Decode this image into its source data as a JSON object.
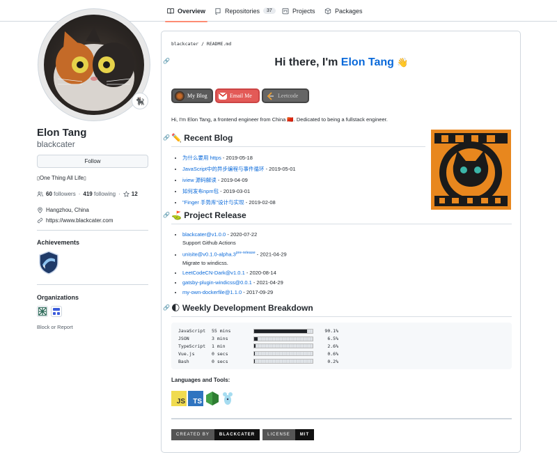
{
  "nav": {
    "tabs": [
      {
        "label": "Overview",
        "icon": "book-icon"
      },
      {
        "label": "Repositories",
        "count": "37",
        "icon": "repo-icon"
      },
      {
        "label": "Projects",
        "icon": "project-icon"
      },
      {
        "label": "Packages",
        "icon": "package-icon"
      }
    ]
  },
  "profile": {
    "name": "Elon Tang",
    "login": "blackcater",
    "status_emoji": "🐈‍⬛",
    "follow_label": "Follow",
    "bio": "One Thing All Life",
    "followers_count": "60",
    "followers_label": "followers",
    "following_count": "419",
    "following_label": "following",
    "stars_count": "12",
    "location": "Hangzhou, China",
    "website": "https://www.blackcater.com"
  },
  "sidebar": {
    "achievements_heading": "Achievements",
    "organizations_heading": "Organizations",
    "block_report": "Block or Report"
  },
  "readme": {
    "breadcrumb_user": "blackcater",
    "breadcrumb_sep": "/",
    "breadcrumb_file": "README.md",
    "greeting": "Hi there, I'm ",
    "greeting_name": "Elon Tang",
    "greeting_emoji": "👋",
    "badges": {
      "blog": "My Blog",
      "email": "Email Me",
      "leetcode": "Leetcode"
    },
    "intro": "Hi, I'm Elon Tang, a frontend engineer from China 🇨🇳. Dedicated to being a fullstack engineer.",
    "recent_blog_heading": "✏️ Recent Blog",
    "blog_posts": [
      {
        "title": "为什么要用 https",
        "date": " - 2019-05-18"
      },
      {
        "title": "JavaScript中的异步编程与事件循环",
        "date": " - 2019-05-01"
      },
      {
        "title": "iview 源码解读",
        "date": " - 2019-04-09"
      },
      {
        "title": "如何发布npm包",
        "date": " - 2019-03-01"
      },
      {
        "title": "\"Finger 手势库\"设计与实现",
        "date": " - 2019-02-08"
      }
    ],
    "project_release_heading": "⛳ Project Release",
    "releases": [
      {
        "title": "blackcater@v1.0.0",
        "sup": "",
        "date": " - 2020-07-22",
        "note": "Support Github Actions"
      },
      {
        "title": "unisite@v0.1.0-alpha.3",
        "sup": "pre-release",
        "date": " - 2021-04-29",
        "note": "Migrate to windicss."
      },
      {
        "title": "LeetCodeCN-Dark@v1.0.1",
        "sup": "",
        "date": " - 2020-08-14",
        "note": ""
      },
      {
        "title": "gatsby-plugin-windicss@0.0.1",
        "sup": "",
        "date": " - 2021-04-29",
        "note": ""
      },
      {
        "title": "my-own-dockerfile@1.1.0",
        "sup": "",
        "date": " - 2017-09-29",
        "note": ""
      }
    ],
    "weekly_heading": "🌓 Weekly Development Breakdown",
    "weekly": [
      {
        "lang": "JavaScript",
        "time": "55 mins",
        "pct": "90.1%",
        "fraction": 0.901
      },
      {
        "lang": "JSON",
        "time": "3 mins",
        "pct": "6.5%",
        "fraction": 0.065
      },
      {
        "lang": "TypeScript",
        "time": "1 min",
        "pct": "2.6%",
        "fraction": 0.026
      },
      {
        "lang": "Vue.js",
        "time": "0 secs",
        "pct": "0.6%",
        "fraction": 0.006
      },
      {
        "lang": "Bash",
        "time": "0 secs",
        "pct": "0.2%",
        "fraction": 0.002
      }
    ],
    "tools_heading": "Languages and Tools:",
    "tools": [
      {
        "label": "JS",
        "icon": "javascript-icon"
      },
      {
        "label": "TS",
        "icon": "typescript-icon"
      },
      {
        "label": "",
        "icon": "nodejs-icon"
      },
      {
        "label": "",
        "icon": "mouse-icon"
      }
    ],
    "shields": [
      {
        "left": "CREATED BY",
        "right": "BLACKCATER"
      },
      {
        "left": "LICENSE",
        "right": "MIT"
      }
    ]
  },
  "colors": {
    "link": "#0969da",
    "tab_underline": "#fd8c73",
    "email_badge": "#e35a57"
  }
}
